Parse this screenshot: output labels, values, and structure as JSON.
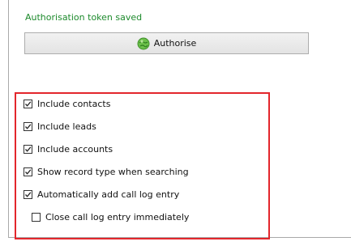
{
  "status_text": "Authorisation token saved",
  "authorise_button": {
    "label": "Authorise",
    "icon": "authorise-globe-icon"
  },
  "options": [
    {
      "label": "Include contacts",
      "checked": true
    },
    {
      "label": "Include leads",
      "checked": true
    },
    {
      "label": "Include accounts",
      "checked": true
    },
    {
      "label": "Show record type when searching",
      "checked": true
    },
    {
      "label": "Automatically add call log entry",
      "checked": true
    },
    {
      "label": "Close call log entry immediately",
      "checked": false
    }
  ],
  "colors": {
    "status": "#1d8a2c",
    "highlight_border": "#e3262c"
  }
}
